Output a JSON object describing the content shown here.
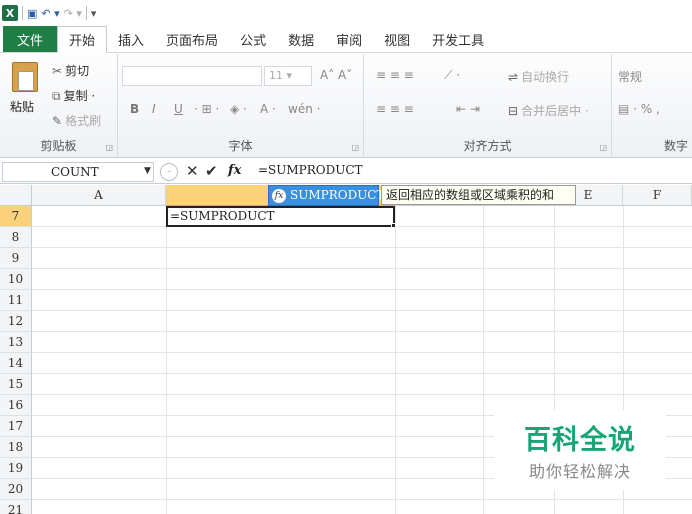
{
  "qat": {
    "app_icon": "X",
    "save_icon": "save-icon",
    "undo_icon": "undo-icon",
    "redo_icon": "redo-icon"
  },
  "tabs": [
    {
      "label": "文件"
    },
    {
      "label": "开始"
    },
    {
      "label": "插入"
    },
    {
      "label": "页面布局"
    },
    {
      "label": "公式"
    },
    {
      "label": "数据"
    },
    {
      "label": "审阅"
    },
    {
      "label": "视图"
    },
    {
      "label": "开发工具"
    }
  ],
  "ribbon": {
    "clipboard": {
      "paste": "粘贴",
      "cut": "剪切",
      "copy": "复制 ·",
      "format_painter": "格式刷",
      "label": "剪贴板"
    },
    "font": {
      "size": "11",
      "label": "字体",
      "bold": "B",
      "italic": "I",
      "underline": "U",
      "wen": "wén"
    },
    "alignment": {
      "wrap": "自动换行",
      "merge": "合并后居中 ·",
      "label": "对齐方式"
    },
    "number": {
      "format": "常规",
      "label": "数字"
    }
  },
  "formula_bar": {
    "name_box": "COUNT",
    "fx": "fx",
    "formula": "=SUMPRODUCT"
  },
  "grid": {
    "columns": [
      "A",
      "",
      "",
      "",
      "E",
      "F"
    ],
    "rows": [
      "7",
      "8",
      "9",
      "10",
      "11",
      "12",
      "13",
      "14",
      "15",
      "16",
      "17",
      "18",
      "19",
      "20",
      "21"
    ],
    "active_cell_text": "=SUMPRODUCT"
  },
  "autocomplete": {
    "item": "SUMPRODUCT",
    "tooltip": "返回相应的数组或区域乘积的和"
  },
  "watermark": {
    "title": "百科全说",
    "subtitle": "助你轻松解决"
  },
  "colors": {
    "excel_green": "#1e7e45",
    "selection_blue": "#3a8fde",
    "header_highlight": "#fbd27c",
    "watermark_green": "#17a673"
  }
}
